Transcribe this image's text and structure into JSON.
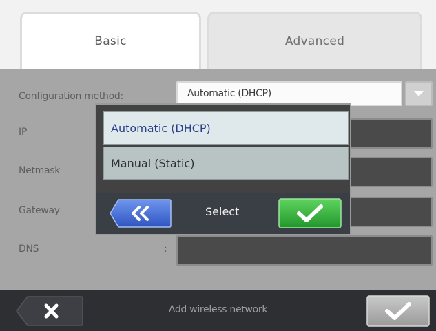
{
  "tabs": [
    {
      "label": "Basic",
      "active": true
    },
    {
      "label": "Advanced",
      "active": false
    }
  ],
  "form": {
    "config_label": "Configuration method:",
    "config_value": "Automatic (DHCP)",
    "ip_label": "IP",
    "netmask_label": "Netmask",
    "gateway_label": "Gateway",
    "dns_label": "DNS",
    "dns_colon": ":"
  },
  "popup": {
    "options": [
      "Automatic (DHCP)",
      "Manual (Static)"
    ],
    "selected_index": 0,
    "title": "Select",
    "back_icon": "double-chevron-left-icon",
    "confirm_icon": "checkmark-icon"
  },
  "bottom_bar": {
    "title": "Add wireless network",
    "cancel_icon": "close-icon",
    "accept_icon": "checkmark-icon"
  },
  "colors": {
    "back_button": "#3f6bd6",
    "confirm_button": "#2fa83a",
    "selected_option_text": "#2a3f8a"
  }
}
